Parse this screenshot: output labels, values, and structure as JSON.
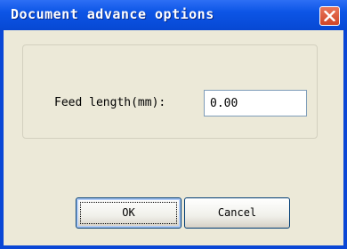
{
  "window": {
    "title": "Document advance options",
    "close_icon": "close-icon"
  },
  "form": {
    "feed_length_label": "Feed length(mm):",
    "feed_length_value": "0.00"
  },
  "buttons": {
    "ok_label": "OK",
    "cancel_label": "Cancel"
  },
  "colors": {
    "titlebar": "#0748d3",
    "client": "#ece9d8",
    "close_button": "#d04526"
  }
}
